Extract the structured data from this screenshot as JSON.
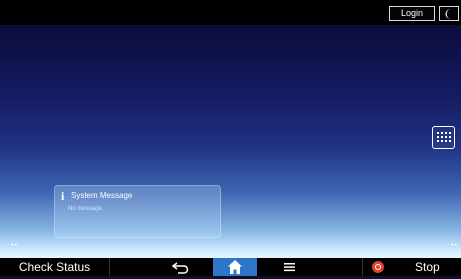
{
  "header": {
    "login_label": "Login",
    "energy_icon": "moon-icon"
  },
  "home": {
    "apps_icon": "app-grid-icon",
    "system_message": {
      "icon": "info-icon",
      "title": "System Message",
      "body": "No message."
    },
    "page_indicator_left": "••",
    "page_indicator_right": "••"
  },
  "footer": {
    "check_status_label": "Check Status",
    "back_icon": "back-arrow-icon",
    "home_icon": "home-icon",
    "menu_icon": "menu-icon",
    "stop_icon": "stop-icon",
    "stop_label": "Stop",
    "home_active_color": "#2e76c8",
    "stop_color": "#e0402c"
  }
}
